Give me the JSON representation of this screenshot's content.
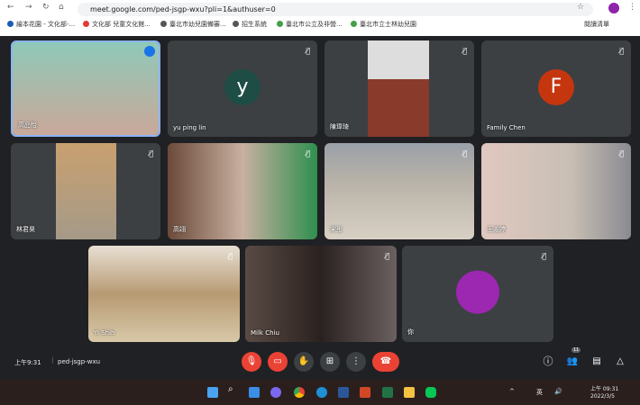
{
  "browser": {
    "url": "meet.google.com/ped-jsgp-wxu?pli=1&authuser=0",
    "reading_list": "閱讀清單",
    "bookmarks": [
      "繪本花園 - 文化部-...",
      "文化部 兒童文化館...",
      "臺北市幼兒園備審...",
      "招生系統",
      "臺北市公立及非營...",
      "臺北市立士林幼兒園"
    ]
  },
  "tiles": [
    {
      "name": "高品怡",
      "color": "#c9a89a",
      "active": true
    },
    {
      "name": "yu ping lin",
      "avatar": "y",
      "avatar_color": "#1e4d45"
    },
    {
      "name": "陳瑋琦",
      "color": "#8a3a2a"
    },
    {
      "name": "Family Chen",
      "avatar": "F",
      "avatar_color": "#c5360f"
    },
    {
      "name": "林君昊",
      "color": "#a59a88"
    },
    {
      "name": "高翊",
      "color": "#8f7f70"
    },
    {
      "name": "宋彤",
      "color": "#b8b2a8"
    },
    {
      "name": "王湘婷",
      "color": "#c8bfb4"
    },
    {
      "name": "Yi Shih",
      "color": "#b79a72"
    },
    {
      "name": "Milk Chiu",
      "color": "#5a4a44"
    },
    {
      "name": "你",
      "avatar_color": "#9c27b0"
    }
  ],
  "meeting": {
    "time": "上午9:31",
    "code": "ped-jsgp-wxu",
    "participants": "11"
  },
  "accent": {
    "end_call": "#ea4335",
    "muted": "#ea4335"
  },
  "taskbar": {
    "lang": "英",
    "time": "上午 09:31",
    "date": "2022/3/5"
  }
}
